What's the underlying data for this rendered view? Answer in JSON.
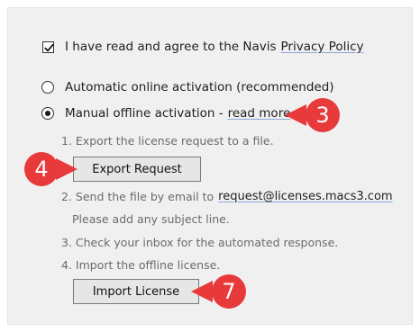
{
  "agreement": {
    "checked": true,
    "label": "I have read and agree to the Navis",
    "link": "Privacy Policy"
  },
  "activation": {
    "automatic_label": "Automatic online activation (recommended)",
    "manual_label": "Manual offline activation -",
    "manual_link": "read more",
    "selected": "manual"
  },
  "steps": {
    "step1": "1. Export the license request to a file.",
    "export_button": "Export Request",
    "step2": "2. Send the file by email to",
    "email": "request@licenses.macs3.com",
    "step2_note": "Please add any subject line.",
    "step3": "3. Check your inbox for the automated response.",
    "step4": "4. Import the offline license.",
    "import_button": "Import License"
  },
  "callouts": {
    "read_more": "3",
    "export": "4",
    "import": "7",
    "color": "#e8393b"
  }
}
